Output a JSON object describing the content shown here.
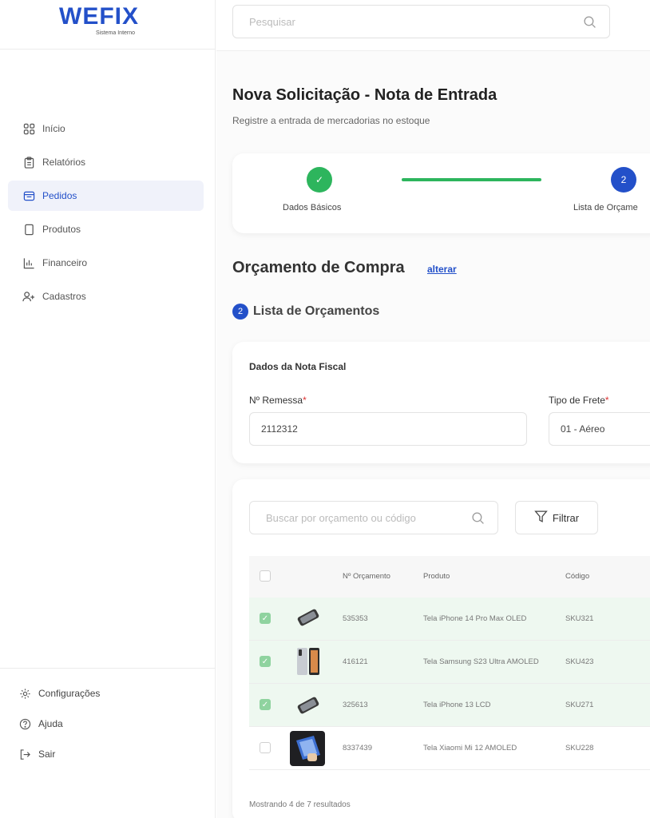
{
  "brand": {
    "name": "WEFIX",
    "subtitle": "Sistema Interno"
  },
  "sidebar": {
    "items": [
      {
        "label": "Início",
        "icon": "grid-icon",
        "active": false
      },
      {
        "label": "Relatórios",
        "icon": "clipboard-icon",
        "active": false
      },
      {
        "label": "Pedidos",
        "icon": "inbox-icon",
        "active": true
      },
      {
        "label": "Produtos",
        "icon": "phone-icon",
        "active": false
      },
      {
        "label": "Financeiro",
        "icon": "bar-chart-icon",
        "active": false
      },
      {
        "label": "Cadastros",
        "icon": "user-plus-icon",
        "active": false
      }
    ],
    "bottom": [
      {
        "label": "Configurações",
        "icon": "gear-icon"
      },
      {
        "label": "Ajuda",
        "icon": "help-icon"
      },
      {
        "label": "Sair",
        "icon": "logout-icon"
      }
    ]
  },
  "topbar": {
    "search_placeholder": "Pesquisar"
  },
  "page": {
    "title": "Nova Solicitação - Nota de Entrada",
    "subtitle": "Registre a entrada de mercadorias no estoque"
  },
  "stepper": {
    "steps": [
      {
        "label": "Dados Básicos",
        "status": "done",
        "symbol": "✓"
      },
      {
        "label": "Lista de Orçame",
        "status": "current",
        "symbol": "2"
      }
    ]
  },
  "section": {
    "title": "Orçamento de Compra",
    "link": "alterar"
  },
  "subsection": {
    "number": "2",
    "title": "Lista de Orçamentos"
  },
  "nota_fiscal": {
    "heading": "Dados da Nota Fiscal",
    "remessa_label": "Nº Remessa",
    "remessa_value": "2112312",
    "frete_label": "Tipo de Frete",
    "frete_value": "01 - Aéreo",
    "required_mark": "*"
  },
  "list": {
    "search_placeholder": "Buscar por orçamento ou código",
    "filter_label": "Filtrar",
    "columns": {
      "orcamento": "Nº Orçamento",
      "produto": "Produto",
      "codigo": "Código"
    },
    "rows": [
      {
        "checked": true,
        "orcamento": "535353",
        "produto": "Tela iPhone 14 Pro Max OLED",
        "codigo": "SKU321"
      },
      {
        "checked": true,
        "orcamento": "416121",
        "produto": "Tela Samsung S23 Ultra AMOLED",
        "codigo": "SKU423"
      },
      {
        "checked": true,
        "orcamento": "325613",
        "produto": "Tela iPhone 13 LCD",
        "codigo": "SKU271"
      },
      {
        "checked": false,
        "orcamento": "8337439",
        "produto": "Tela Xiaomi Mi 12 AMOLED",
        "codigo": "SKU228"
      }
    ],
    "footer": "Mostrando 4 de 7 resultados"
  },
  "colors": {
    "primary": "#2350c9",
    "success": "#2db55d",
    "selected_row": "#eef8f0"
  }
}
